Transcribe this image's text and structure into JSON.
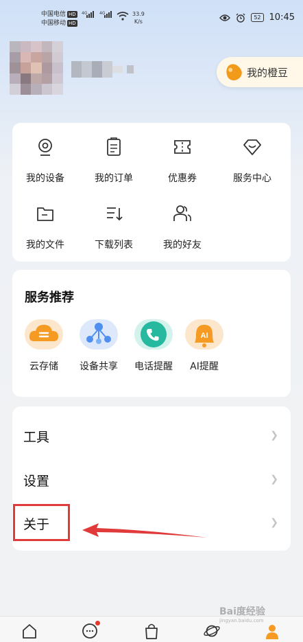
{
  "status_bar": {
    "carrier1": "中国电信",
    "carrier2": "中国移动",
    "hd": "HD",
    "net1": "4G",
    "net2": "4G",
    "speed_value": "33.9",
    "speed_unit": "K/s",
    "battery": "52",
    "time": "10:45"
  },
  "profile": {
    "orange_beans_label": "我的橙豆"
  },
  "quick_menu": {
    "items": [
      {
        "label": "我的设备",
        "icon": "camera-device-icon"
      },
      {
        "label": "我的订单",
        "icon": "clipboard-order-icon"
      },
      {
        "label": "优惠券",
        "icon": "coupon-ticket-icon"
      },
      {
        "label": "服务中心",
        "icon": "service-center-icon"
      },
      {
        "label": "我的文件",
        "icon": "folder-icon"
      },
      {
        "label": "下载列表",
        "icon": "download-list-icon"
      },
      {
        "label": "我的好友",
        "icon": "friends-icon"
      }
    ]
  },
  "services": {
    "title": "服务推荐",
    "items": [
      {
        "label": "云存储",
        "icon": "cloud-storage-icon",
        "color": "#f59a23"
      },
      {
        "label": "设备共享",
        "icon": "device-share-icon",
        "color": "#4f8ff0"
      },
      {
        "label": "电话提醒",
        "icon": "phone-reminder-icon",
        "color": "#27b8a0"
      },
      {
        "label": "AI提醒",
        "icon": "ai-reminder-icon",
        "color": "#f59a23"
      }
    ]
  },
  "settings_menu": {
    "items": [
      {
        "label": "工具"
      },
      {
        "label": "设置"
      },
      {
        "label": "关于"
      }
    ]
  },
  "watermark": {
    "main": "Bai度经验",
    "sub": "jingyan.baidu.com"
  },
  "colors": {
    "accent_orange": "#f59a23",
    "highlight_red": "#e03a3a"
  }
}
